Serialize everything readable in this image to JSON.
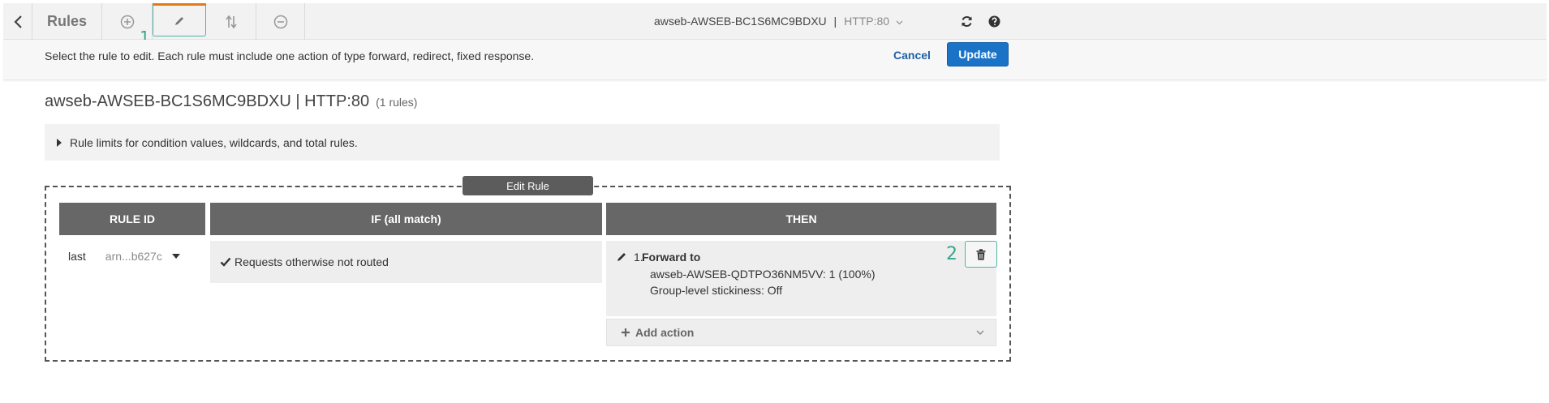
{
  "toolbar": {
    "title": "Rules",
    "lb_name": "awseb-AWSEB-BC1S6MC9BDXU",
    "lb_sep": "|",
    "lb_port": "HTTP:80",
    "annotation_1": "1",
    "icons": [
      "back-icon",
      "add-icon",
      "edit-icon",
      "reorder-icon",
      "remove-icon",
      "refresh-icon",
      "help-icon"
    ]
  },
  "instructions": {
    "text": "Select the rule to edit. Each rule must include one action of type forward, redirect, fixed response.",
    "cancel_label": "Cancel",
    "update_label": "Update"
  },
  "heading": {
    "title": "awseb-AWSEB-BC1S6MC9BDXU | HTTP:80",
    "count": "(1 rules)"
  },
  "limits": {
    "label": "Rule limits for condition values, wildcards, and total rules."
  },
  "edit_rule": {
    "tag": "Edit Rule",
    "columns": [
      "RULE ID",
      "IF (all match)",
      "THEN"
    ],
    "rule": {
      "priority": "last",
      "arn": "arn...b627c",
      "condition": "Requests otherwise not routed",
      "action_number": "1.",
      "action_title": "Forward to",
      "action_target": "awseb-AWSEB-QDTPO36NM5VV: 1 (100%)",
      "action_stickiness": "Group-level stickiness: Off",
      "annotation_2": "2"
    },
    "add_action_label": "Add action"
  },
  "colors": {
    "accent_blue": "#1a73c7",
    "link_blue": "#1f5fa8",
    "header_gray": "#676767",
    "annotation_green": "#3aa58d",
    "active_tab_orange": "#e47911"
  }
}
